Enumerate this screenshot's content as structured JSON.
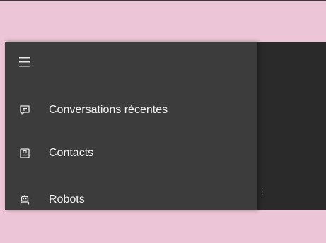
{
  "nav": {
    "menu_icon": "hamburger-icon",
    "items": [
      {
        "label": "Conversations récentes",
        "icon": "chat-icon"
      },
      {
        "label": "Contacts",
        "icon": "contact-card-icon"
      },
      {
        "label": "Robots",
        "icon": "robot-icon"
      }
    ]
  },
  "colors": {
    "background": "#ecc6d6",
    "nav_pane": "#3c3c3c",
    "content": "#2a2a2a",
    "text": "#f2f2f2"
  }
}
